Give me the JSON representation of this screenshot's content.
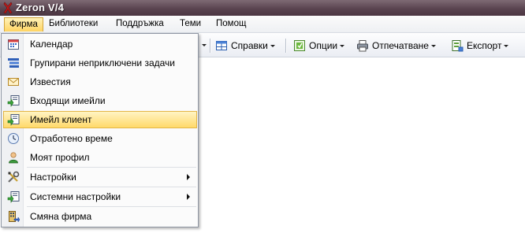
{
  "window": {
    "title": "Zeron V/4"
  },
  "menubar": {
    "items": [
      {
        "label": "Фирма"
      },
      {
        "label": "Библиотеки"
      },
      {
        "label": "Поддръжка"
      },
      {
        "label": "Теми"
      },
      {
        "label": "Помощ"
      }
    ]
  },
  "toolbar": {
    "buttons": [
      {
        "label": "Справки",
        "icon": "reports-icon"
      },
      {
        "label": "Опции",
        "icon": "options-icon"
      },
      {
        "label": "Отпечатване",
        "icon": "printer-icon"
      },
      {
        "label": "Експорт",
        "icon": "export-icon"
      }
    ]
  },
  "dropdown": {
    "items": [
      {
        "label": "Календар",
        "icon": "calendar-icon"
      },
      {
        "label": "Групирани неприключени задачи",
        "icon": "grouped-tasks-icon"
      },
      {
        "label": "Известия",
        "icon": "envelope-icon"
      },
      {
        "label": "Входящи имейли",
        "icon": "inbox-icon"
      },
      {
        "label": "Имейл клиент",
        "icon": "email-client-icon"
      },
      {
        "label": "Отработено време",
        "icon": "clock-icon"
      },
      {
        "label": "Моят профил",
        "icon": "user-icon"
      },
      {
        "label": "Настройки",
        "icon": "tools-icon"
      },
      {
        "label": "Системни настройки",
        "icon": "system-settings-icon"
      },
      {
        "label": "Смяна фирма",
        "icon": "change-company-icon"
      }
    ]
  },
  "colors": {
    "titlebar": "#5a4450",
    "highlight": "#ffd96a",
    "highlight_border": "#e3b546"
  }
}
